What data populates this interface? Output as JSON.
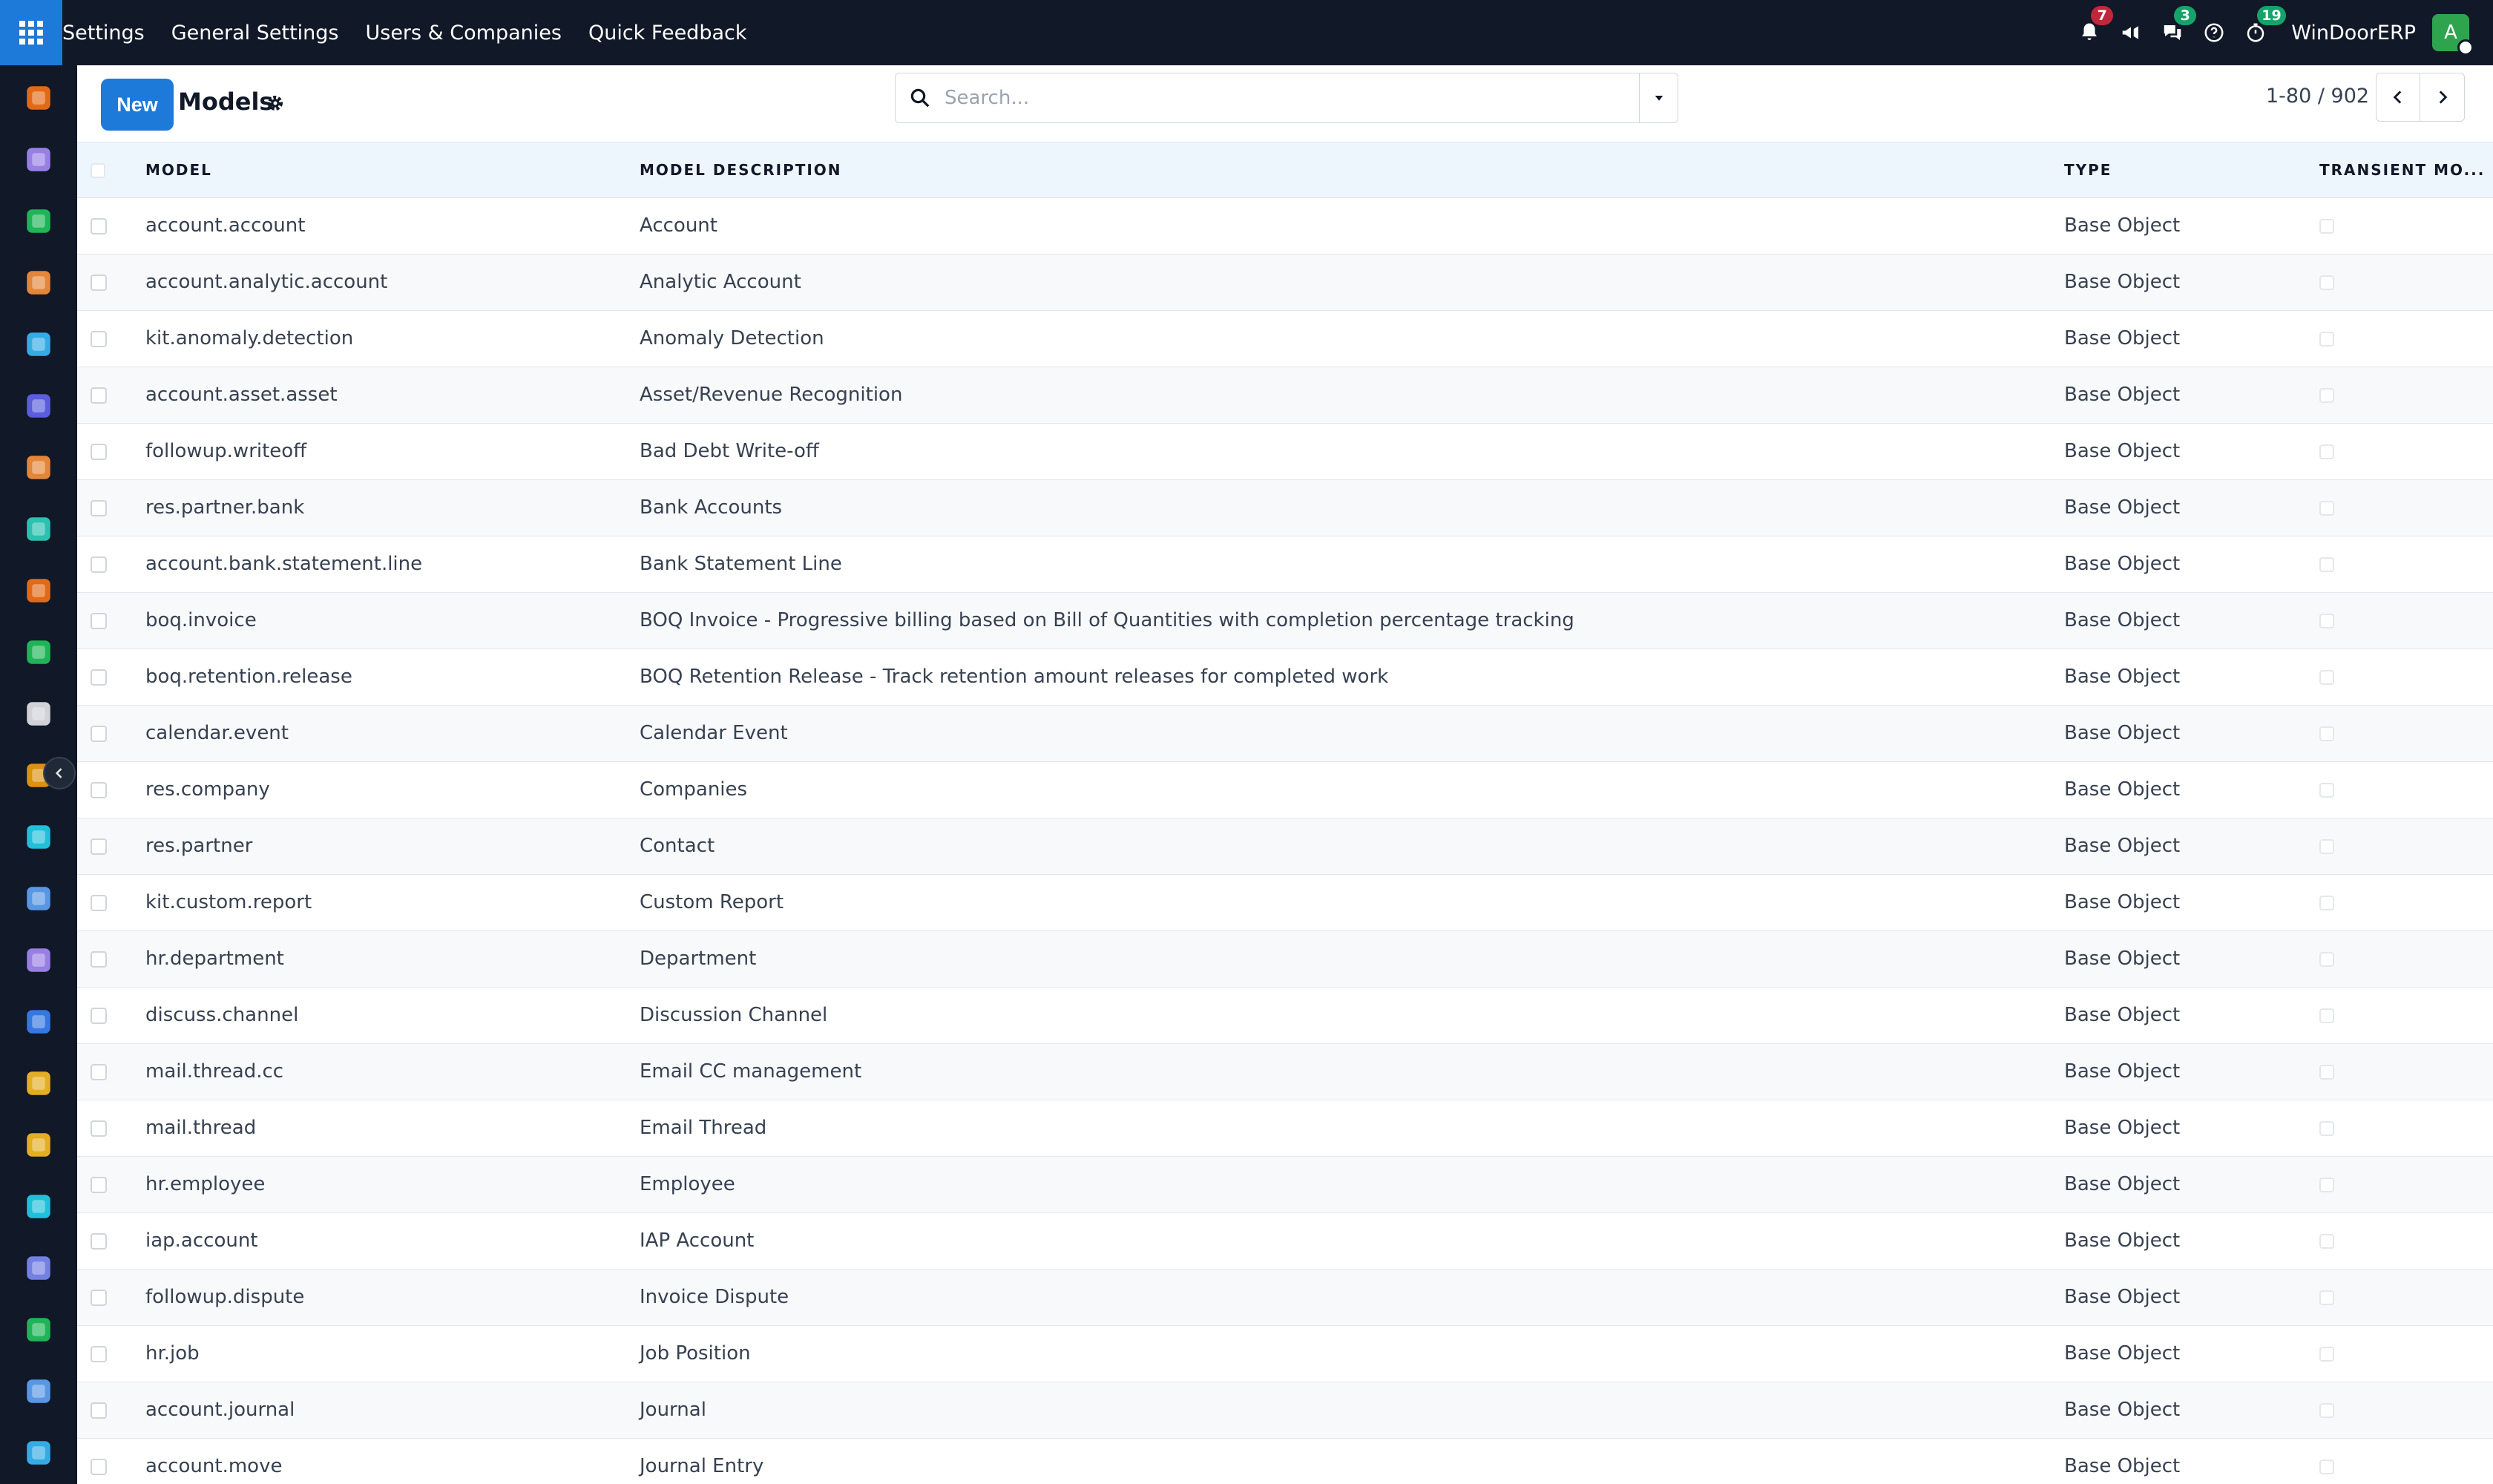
{
  "navbar": {
    "menu": [
      "Settings",
      "General Settings",
      "Users & Companies",
      "Quick Feedback"
    ],
    "badges": {
      "activity": "7",
      "messages": "3",
      "timer": "19"
    },
    "company": "WinDoorERP",
    "avatar_initial": "A"
  },
  "sidebar": {
    "apps": [
      {
        "icon": "invoicing-icon",
        "color": "#f97316"
      },
      {
        "icon": "project-icon",
        "color": "#a78bfa"
      },
      {
        "icon": "contacts-icon",
        "color": "#22c55e"
      },
      {
        "icon": "discuss-icon",
        "color": "#fb923c"
      },
      {
        "icon": "helpdesk-icon",
        "color": "#38bdf8"
      },
      {
        "icon": "email-marketing-icon",
        "color": "#6366f1"
      },
      {
        "icon": "chat-icon",
        "color": "#fb923c"
      },
      {
        "icon": "sign-icon",
        "color": "#2dd4bf"
      },
      {
        "icon": "accounting-icon",
        "color": "#f97316"
      },
      {
        "icon": "employees-icon",
        "color": "#22c55e"
      },
      {
        "icon": "inventory-icon",
        "color": "#e5e7eb"
      },
      {
        "icon": "planning-icon",
        "color": "#f59e0b"
      },
      {
        "icon": "todo-icon",
        "color": "#22d3ee"
      },
      {
        "icon": "knowledge-icon",
        "color": "#60a5fa"
      },
      {
        "icon": "apps-store-icon",
        "color": "#a78bfa"
      },
      {
        "icon": "expenses-icon",
        "color": "#3b82f6"
      },
      {
        "icon": "team-icon",
        "color": "#fbbf24"
      },
      {
        "icon": "calendar-icon",
        "color": "#fbbf24"
      },
      {
        "icon": "edit-icon",
        "color": "#22d3ee"
      },
      {
        "icon": "dashboards-icon",
        "color": "#818cf8"
      },
      {
        "icon": "whatsapp-icon",
        "color": "#22c55e"
      },
      {
        "icon": "timesheet-icon",
        "color": "#60a5fa"
      },
      {
        "icon": "helpdesk2-icon",
        "color": "#38bdf8"
      }
    ]
  },
  "control": {
    "new_label": "New",
    "title": "Models",
    "search_placeholder": "Search...",
    "pager": "1-80 / 902"
  },
  "table": {
    "headers": {
      "model": "Model",
      "description": "Model Description",
      "type": "Type",
      "transient": "Transient Mo..."
    },
    "rows": [
      {
        "model": "account.account",
        "description": "Account",
        "type": "Base Object",
        "transient": false
      },
      {
        "model": "account.analytic.account",
        "description": "Analytic Account",
        "type": "Base Object",
        "transient": false
      },
      {
        "model": "kit.anomaly.detection",
        "description": "Anomaly Detection",
        "type": "Base Object",
        "transient": false
      },
      {
        "model": "account.asset.asset",
        "description": "Asset/Revenue Recognition",
        "type": "Base Object",
        "transient": false
      },
      {
        "model": "followup.writeoff",
        "description": "Bad Debt Write-off",
        "type": "Base Object",
        "transient": false
      },
      {
        "model": "res.partner.bank",
        "description": "Bank Accounts",
        "type": "Base Object",
        "transient": false
      },
      {
        "model": "account.bank.statement.line",
        "description": "Bank Statement Line",
        "type": "Base Object",
        "transient": false
      },
      {
        "model": "boq.invoice",
        "description": "BOQ Invoice - Progressive billing based on Bill of Quantities with completion percentage tracking",
        "type": "Base Object",
        "transient": false
      },
      {
        "model": "boq.retention.release",
        "description": "BOQ Retention Release - Track retention amount releases for completed work",
        "type": "Base Object",
        "transient": false
      },
      {
        "model": "calendar.event",
        "description": "Calendar Event",
        "type": "Base Object",
        "transient": false
      },
      {
        "model": "res.company",
        "description": "Companies",
        "type": "Base Object",
        "transient": false
      },
      {
        "model": "res.partner",
        "description": "Contact",
        "type": "Base Object",
        "transient": false
      },
      {
        "model": "kit.custom.report",
        "description": "Custom Report",
        "type": "Base Object",
        "transient": false
      },
      {
        "model": "hr.department",
        "description": "Department",
        "type": "Base Object",
        "transient": false
      },
      {
        "model": "discuss.channel",
        "description": "Discussion Channel",
        "type": "Base Object",
        "transient": false
      },
      {
        "model": "mail.thread.cc",
        "description": "Email CC management",
        "type": "Base Object",
        "transient": false
      },
      {
        "model": "mail.thread",
        "description": "Email Thread",
        "type": "Base Object",
        "transient": false
      },
      {
        "model": "hr.employee",
        "description": "Employee",
        "type": "Base Object",
        "transient": false
      },
      {
        "model": "iap.account",
        "description": "IAP Account",
        "type": "Base Object",
        "transient": false
      },
      {
        "model": "followup.dispute",
        "description": "Invoice Dispute",
        "type": "Base Object",
        "transient": false
      },
      {
        "model": "hr.job",
        "description": "Job Position",
        "type": "Base Object",
        "transient": false
      },
      {
        "model": "account.journal",
        "description": "Journal",
        "type": "Base Object",
        "transient": false
      },
      {
        "model": "account.move",
        "description": "Journal Entry",
        "type": "Base Object",
        "transient": false
      }
    ]
  }
}
